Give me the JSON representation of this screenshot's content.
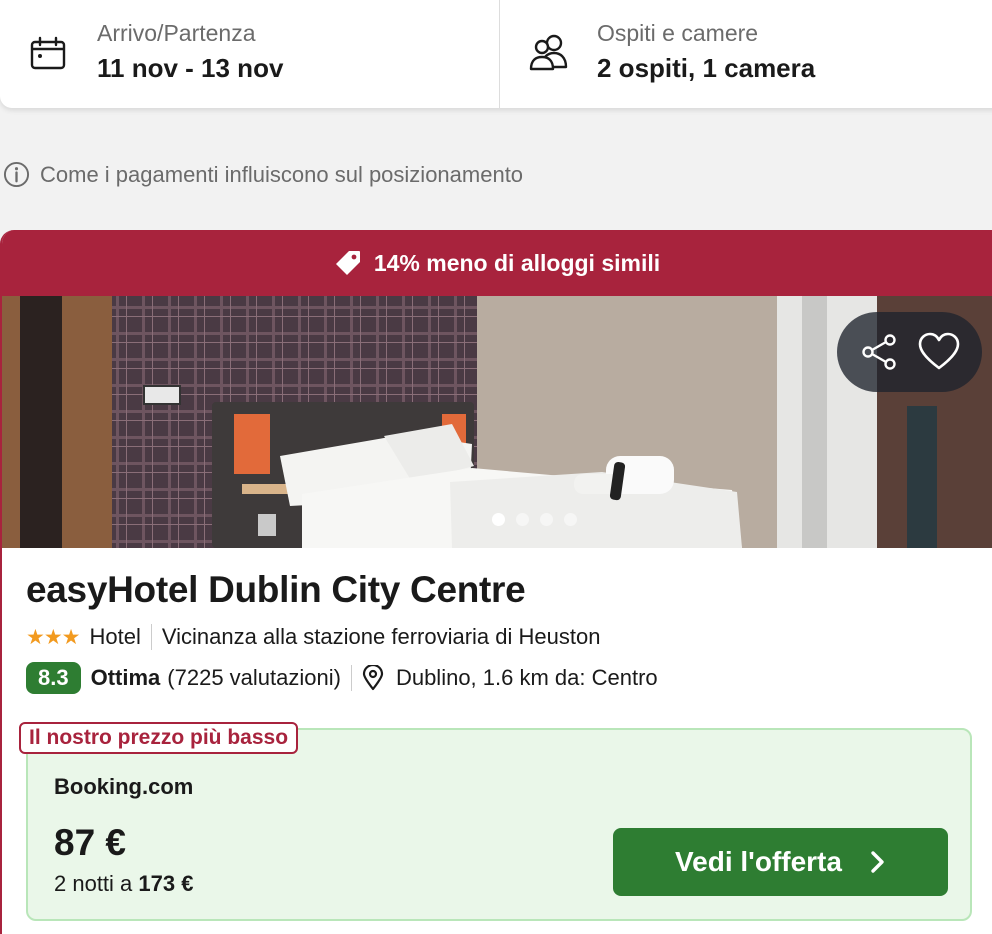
{
  "search": {
    "dates_label": "Arrivo/Partenza",
    "dates_value": "11 nov - 13 nov",
    "guests_label": "Ospiti e camere",
    "guests_value": "2 ospiti, 1 camera",
    "dates_icon": "calendar-icon",
    "guests_icon": "users-icon"
  },
  "info": {
    "text": "Come i pagamenti influiscono sul posizionamento",
    "icon": "info-icon"
  },
  "hotel": {
    "deal_text": "14% meno di alloggi simili",
    "deal_icon": "tag-icon",
    "name": "easyHotel Dublin City Centre",
    "stars": "★★★",
    "star_count": 3,
    "type": "Hotel",
    "feature": "Vicinanza alla stazione ferroviaria di Heuston",
    "rating": "8.3",
    "rating_word": "Ottima",
    "reviews": "(7225 valutazioni)",
    "location": "Dublino, 1.6 km da: Centro",
    "photo_count": 4,
    "photo_index": 1,
    "share_icon": "share-icon",
    "favorite_icon": "heart-icon"
  },
  "offer": {
    "badge": "Il nostro prezzo più basso",
    "provider": "Booking.com",
    "price": "87 €",
    "nights_prefix": "2 notti a",
    "total": "173 €",
    "cta_label": "Vedi l'offerta",
    "cta_icon": "chevron-right-icon"
  },
  "colors": {
    "brand_red": "#a8233d",
    "accent_green": "#2e7d32",
    "offer_bg": "#eaf7e9",
    "star": "#f29a1f"
  }
}
